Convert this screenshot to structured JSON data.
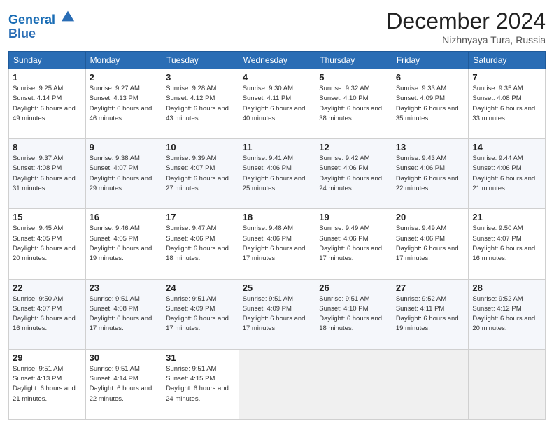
{
  "header": {
    "logo_line1": "General",
    "logo_line2": "Blue",
    "month_title": "December 2024",
    "location": "Nizhnyaya Tura, Russia"
  },
  "days_of_week": [
    "Sunday",
    "Monday",
    "Tuesday",
    "Wednesday",
    "Thursday",
    "Friday",
    "Saturday"
  ],
  "weeks": [
    [
      {
        "day": 1,
        "sunrise": "9:25 AM",
        "sunset": "4:14 PM",
        "daylight": "6 hours and 49 minutes."
      },
      {
        "day": 2,
        "sunrise": "9:27 AM",
        "sunset": "4:13 PM",
        "daylight": "6 hours and 46 minutes."
      },
      {
        "day": 3,
        "sunrise": "9:28 AM",
        "sunset": "4:12 PM",
        "daylight": "6 hours and 43 minutes."
      },
      {
        "day": 4,
        "sunrise": "9:30 AM",
        "sunset": "4:11 PM",
        "daylight": "6 hours and 40 minutes."
      },
      {
        "day": 5,
        "sunrise": "9:32 AM",
        "sunset": "4:10 PM",
        "daylight": "6 hours and 38 minutes."
      },
      {
        "day": 6,
        "sunrise": "9:33 AM",
        "sunset": "4:09 PM",
        "daylight": "6 hours and 35 minutes."
      },
      {
        "day": 7,
        "sunrise": "9:35 AM",
        "sunset": "4:08 PM",
        "daylight": "6 hours and 33 minutes."
      }
    ],
    [
      {
        "day": 8,
        "sunrise": "9:37 AM",
        "sunset": "4:08 PM",
        "daylight": "6 hours and 31 minutes."
      },
      {
        "day": 9,
        "sunrise": "9:38 AM",
        "sunset": "4:07 PM",
        "daylight": "6 hours and 29 minutes."
      },
      {
        "day": 10,
        "sunrise": "9:39 AM",
        "sunset": "4:07 PM",
        "daylight": "6 hours and 27 minutes."
      },
      {
        "day": 11,
        "sunrise": "9:41 AM",
        "sunset": "4:06 PM",
        "daylight": "6 hours and 25 minutes."
      },
      {
        "day": 12,
        "sunrise": "9:42 AM",
        "sunset": "4:06 PM",
        "daylight": "6 hours and 24 minutes."
      },
      {
        "day": 13,
        "sunrise": "9:43 AM",
        "sunset": "4:06 PM",
        "daylight": "6 hours and 22 minutes."
      },
      {
        "day": 14,
        "sunrise": "9:44 AM",
        "sunset": "4:06 PM",
        "daylight": "6 hours and 21 minutes."
      }
    ],
    [
      {
        "day": 15,
        "sunrise": "9:45 AM",
        "sunset": "4:05 PM",
        "daylight": "6 hours and 20 minutes."
      },
      {
        "day": 16,
        "sunrise": "9:46 AM",
        "sunset": "4:05 PM",
        "daylight": "6 hours and 19 minutes."
      },
      {
        "day": 17,
        "sunrise": "9:47 AM",
        "sunset": "4:06 PM",
        "daylight": "6 hours and 18 minutes."
      },
      {
        "day": 18,
        "sunrise": "9:48 AM",
        "sunset": "4:06 PM",
        "daylight": "6 hours and 17 minutes."
      },
      {
        "day": 19,
        "sunrise": "9:49 AM",
        "sunset": "4:06 PM",
        "daylight": "6 hours and 17 minutes."
      },
      {
        "day": 20,
        "sunrise": "9:49 AM",
        "sunset": "4:06 PM",
        "daylight": "6 hours and 17 minutes."
      },
      {
        "day": 21,
        "sunrise": "9:50 AM",
        "sunset": "4:07 PM",
        "daylight": "6 hours and 16 minutes."
      }
    ],
    [
      {
        "day": 22,
        "sunrise": "9:50 AM",
        "sunset": "4:07 PM",
        "daylight": "6 hours and 16 minutes."
      },
      {
        "day": 23,
        "sunrise": "9:51 AM",
        "sunset": "4:08 PM",
        "daylight": "6 hours and 17 minutes."
      },
      {
        "day": 24,
        "sunrise": "9:51 AM",
        "sunset": "4:09 PM",
        "daylight": "6 hours and 17 minutes."
      },
      {
        "day": 25,
        "sunrise": "9:51 AM",
        "sunset": "4:09 PM",
        "daylight": "6 hours and 17 minutes."
      },
      {
        "day": 26,
        "sunrise": "9:51 AM",
        "sunset": "4:10 PM",
        "daylight": "6 hours and 18 minutes."
      },
      {
        "day": 27,
        "sunrise": "9:52 AM",
        "sunset": "4:11 PM",
        "daylight": "6 hours and 19 minutes."
      },
      {
        "day": 28,
        "sunrise": "9:52 AM",
        "sunset": "4:12 PM",
        "daylight": "6 hours and 20 minutes."
      }
    ],
    [
      {
        "day": 29,
        "sunrise": "9:51 AM",
        "sunset": "4:13 PM",
        "daylight": "6 hours and 21 minutes."
      },
      {
        "day": 30,
        "sunrise": "9:51 AM",
        "sunset": "4:14 PM",
        "daylight": "6 hours and 22 minutes."
      },
      {
        "day": 31,
        "sunrise": "9:51 AM",
        "sunset": "4:15 PM",
        "daylight": "6 hours and 24 minutes."
      },
      null,
      null,
      null,
      null
    ]
  ]
}
